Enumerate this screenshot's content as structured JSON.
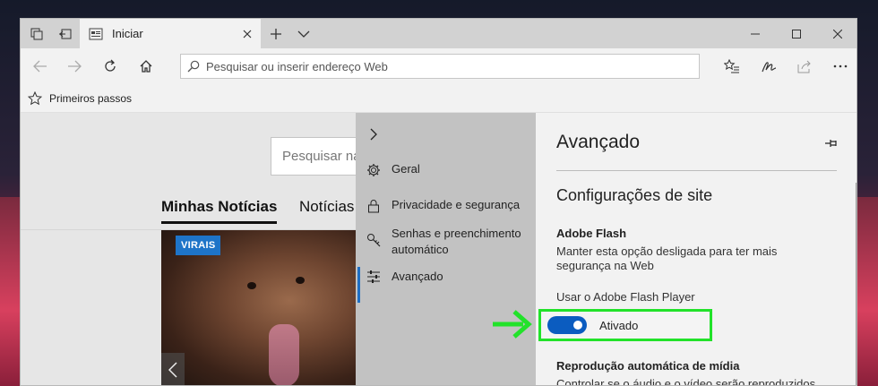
{
  "browser": {
    "tab": {
      "title": "Iniciar"
    },
    "address": {
      "placeholder": "Pesquisar ou inserir endereço Web"
    },
    "favorites": [
      {
        "label": "Primeiros passos"
      }
    ]
  },
  "page": {
    "search_placeholder": "Pesquisar na",
    "news_tabs": [
      {
        "label": "Minhas Notícias"
      },
      {
        "label": "Notícias"
      }
    ],
    "card": {
      "badge": "VIRAIS"
    }
  },
  "menu": {
    "items": [
      {
        "label": "Geral",
        "icon": "gear-icon"
      },
      {
        "label": "Privacidade e segurança",
        "icon": "lock-icon"
      },
      {
        "label": "Senhas e preenchimento automático",
        "icon": "key-icon"
      },
      {
        "label": "Avançado",
        "icon": "sliders-icon",
        "selected": true
      }
    ]
  },
  "settings": {
    "title": "Avançado",
    "subtitle": "Configurações de site",
    "flash": {
      "heading": "Adobe Flash",
      "description": "Manter esta opção desligada para ter mais segurança na Web",
      "toggle_caption": "Usar o Adobe Flash Player",
      "toggle_state": "Ativado",
      "enabled": true
    },
    "autoplay": {
      "heading": "Reprodução automática de mídia",
      "description": "Controlar se o áudio e o vídeo serão reproduzidos"
    }
  },
  "colors": {
    "accent": "#0b5cc0",
    "highlight": "#22e22a",
    "badge": "#1e74c8"
  }
}
